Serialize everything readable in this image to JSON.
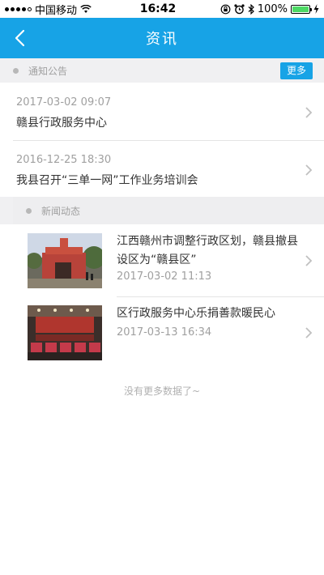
{
  "status_bar": {
    "carrier": "中国移动",
    "time": "16:42",
    "battery_percent": "100%",
    "battery_level": 1.0,
    "colors": {
      "battery_fill": "#4cd964"
    }
  },
  "nav": {
    "title": "资讯",
    "back_icon": "chevron-left-icon",
    "colors": {
      "background": "#17a3e6"
    }
  },
  "notices": {
    "section_label": "通知公告",
    "more_label": "更多",
    "items": [
      {
        "date": "2017-03-02 09:07",
        "title": "赣县行政服务中心"
      },
      {
        "date": "2016-12-25 18:30",
        "title": "我县召开“三单一网”工作业务培训会"
      }
    ]
  },
  "news": {
    "section_label": "新闻动态",
    "items": [
      {
        "title": "江西赣州市调整行政区划，赣县撤县设区为“赣县区”",
        "date": "2017-03-02 11:13",
        "image": "government-building-photo"
      },
      {
        "title": "区行政服务中心乐捐善款暖民心",
        "date": "2017-03-13 16:34",
        "image": "meeting-hall-photo"
      }
    ]
  },
  "footer": {
    "end_text": "没有更多数据了~"
  }
}
